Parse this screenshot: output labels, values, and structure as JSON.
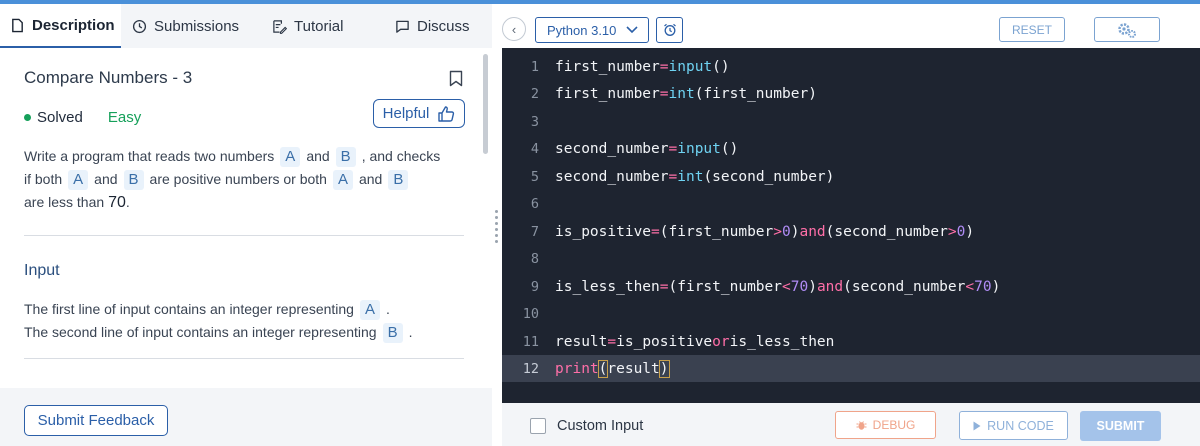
{
  "tabs": [
    {
      "label": "Description",
      "icon": "file-icon",
      "active": true
    },
    {
      "label": "Submissions",
      "icon": "clock-icon",
      "active": false
    },
    {
      "label": "Tutorial",
      "icon": "edit-icon",
      "active": false
    },
    {
      "label": "Discuss",
      "icon": "chat-icon",
      "active": false
    }
  ],
  "problem": {
    "title": "Compare Numbers - 3",
    "status": "Solved",
    "difficulty": "Easy",
    "helpful_label": "Helpful",
    "statement": {
      "p1": "Write a program that reads two numbers",
      "a": "A",
      "and": "and",
      "b": "B",
      "p2": ", and checks",
      "p3": "if both",
      "p4": "are positive numbers or both",
      "p5": "are less than",
      "limit": "70",
      "period": "."
    }
  },
  "input_section": {
    "title": "Input",
    "line1": "The first line of input contains an integer representing",
    "line2": "The second line of input contains an integer representing",
    "a": "A",
    "b": "B",
    "period": "."
  },
  "feedback_label": "Submit Feedback",
  "editor": {
    "back_icon": "chevron-left-icon",
    "language": "Python 3.10",
    "reset_label": "RESET",
    "line_numbers": [
      "1",
      "2",
      "3",
      "4",
      "5",
      "6",
      "7",
      "8",
      "9",
      "10",
      "11",
      "12"
    ],
    "current_line": 12
  },
  "footer": {
    "custom_input_label": "Custom Input",
    "debug_label": "DEBUG",
    "run_label": "RUN CODE",
    "submit_label": "SUBMIT"
  },
  "code": {
    "l1": {
      "var": "first_number",
      "eq": "=",
      "fn": "input",
      "rest": "()"
    },
    "l2": {
      "var": "first_number",
      "eq": "=",
      "fn": "int",
      "rest": "(first_number)"
    },
    "l4": {
      "var": "second_number",
      "eq": "=",
      "fn": "input",
      "rest": "()"
    },
    "l5": {
      "var": "second_number",
      "eq": "=",
      "fn": "int",
      "rest": "(second_number)"
    },
    "l7": {
      "var": "is_positive",
      "eq": "=",
      "a": "(first_number",
      "gt": ">",
      "z1": "0",
      "c": ")",
      "and": "and",
      "b": "(second_number",
      "z2": "0",
      "d": ")"
    },
    "l9": {
      "var": "is_less_then",
      "eq": "=",
      "a": "(first_number",
      "lt": "<",
      "n1": "70",
      "c": ")",
      "and": "and",
      "b": "(second_number",
      "n2": "70",
      "d": ")"
    },
    "l11": {
      "var": "result",
      "eq": "=",
      "a": "is_positive",
      "or": "or",
      "b": "is_less_then"
    },
    "l12": {
      "fn": "print",
      "open": "(",
      "arg": "result",
      "close": ")"
    }
  },
  "colors": {
    "accent": "#2b5fa8",
    "success": "#16a05a",
    "editor_bg": "#1e2430",
    "keyword": "#ff6fa8",
    "function": "#6fd3f2",
    "number": "#b08cf5"
  }
}
